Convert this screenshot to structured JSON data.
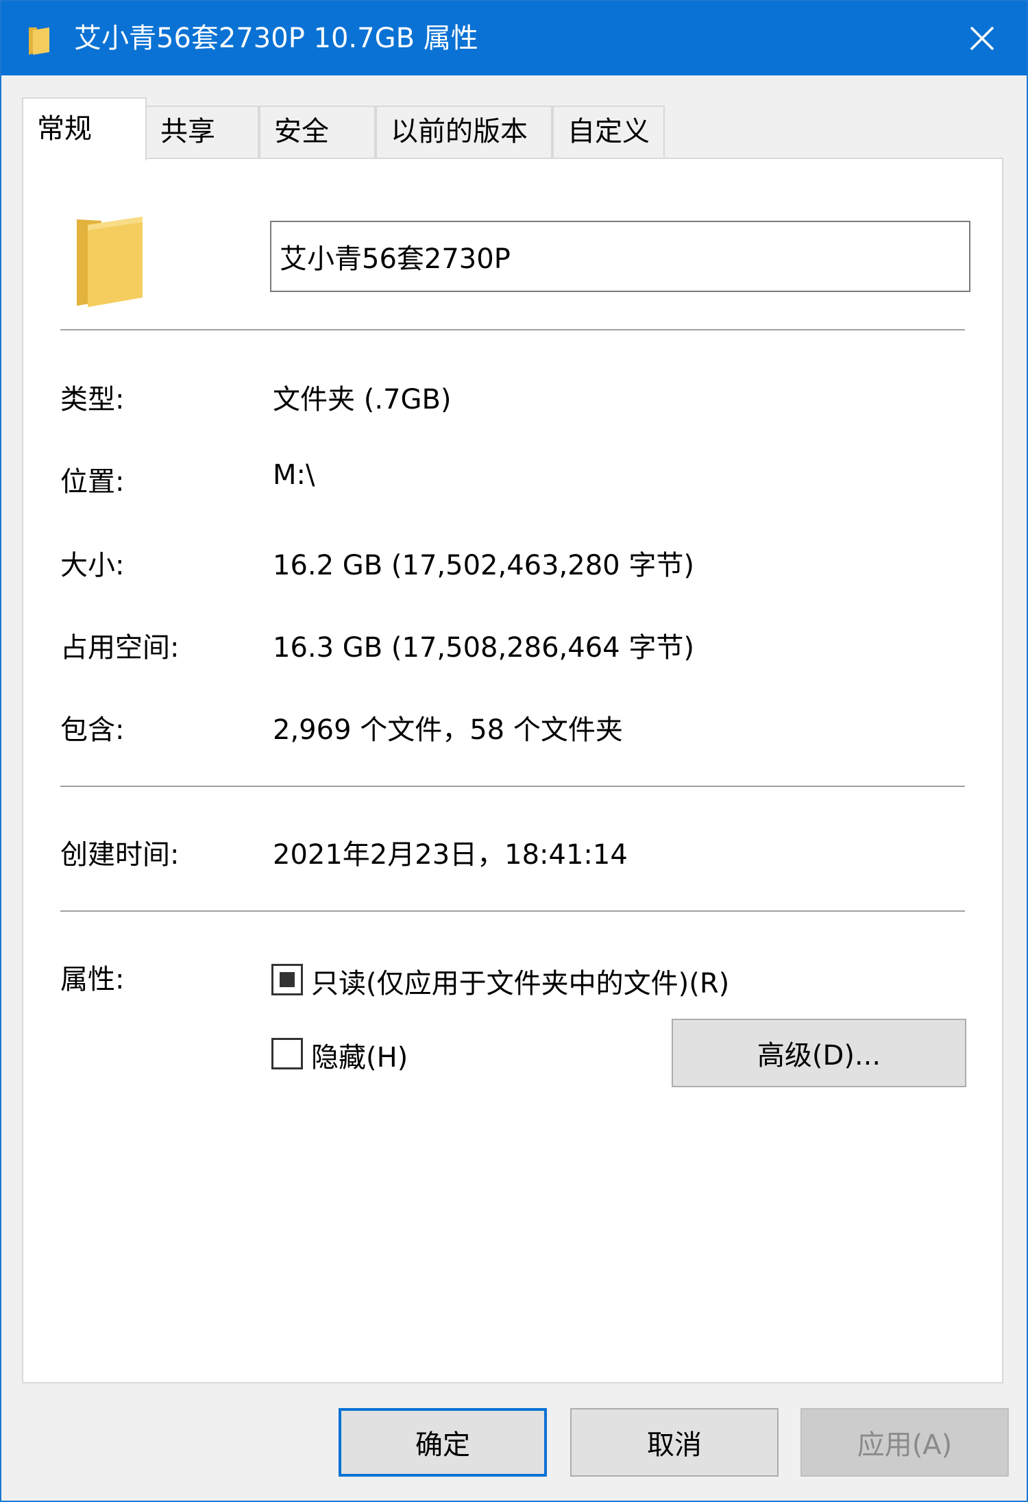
{
  "window": {
    "title": "艾小青56套2730P 10.7GB 属性"
  },
  "tabs": [
    {
      "label": "常规"
    },
    {
      "label": "共享"
    },
    {
      "label": "安全"
    },
    {
      "label": "以前的版本"
    },
    {
      "label": "自定义"
    }
  ],
  "general": {
    "name_value": "艾小青56套2730P",
    "type": {
      "label": "类型:",
      "value": "文件夹 (.7GB)"
    },
    "location": {
      "label": "位置:",
      "value": "M:\\"
    },
    "size": {
      "label": "大小:",
      "value": "16.2 GB (17,502,463,280 字节)"
    },
    "size_on_disk": {
      "label": "占用空间:",
      "value": "16.3 GB (17,508,286,464 字节)"
    },
    "contains": {
      "label": "包含:",
      "value": "2,969 个文件，58 个文件夹"
    },
    "created": {
      "label": "创建时间:",
      "value": "2021年2月23日，18:41:14"
    },
    "attributes": {
      "label": "属性:",
      "readonly_label": "只读(仅应用于文件夹中的文件)(R)",
      "readonly_state": "indeterminate",
      "hidden_label": "隐藏(H)",
      "hidden_checked": false,
      "advanced_button": "高级(D)..."
    }
  },
  "footer": {
    "ok": "确定",
    "cancel": "取消",
    "apply": "应用(A)"
  },
  "colors": {
    "titlebar": "#0a72d4",
    "folder": "#f4cd5e",
    "default_button_border": "#0a72d4"
  },
  "icons": {
    "title_icon": "folder-icon",
    "close_icon": "close-icon",
    "main_icon": "folder-icon"
  }
}
